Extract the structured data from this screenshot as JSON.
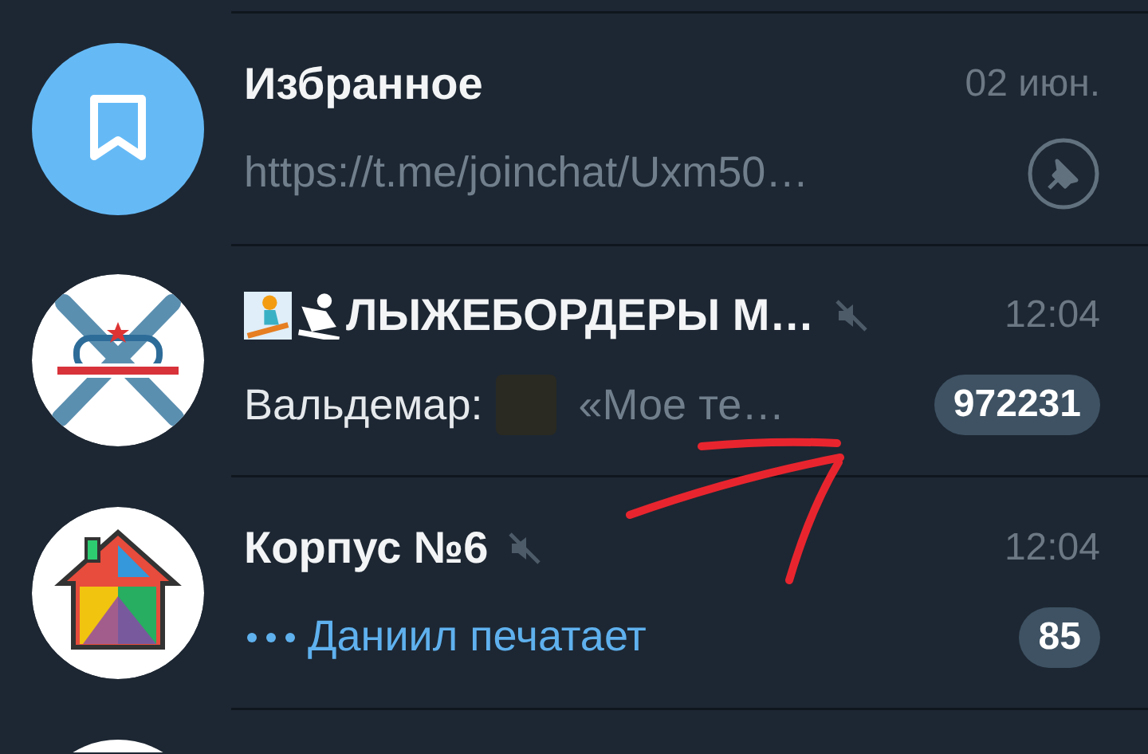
{
  "chats": [
    {
      "avatar": {
        "kind": "bookmark"
      },
      "title": "Избранное",
      "muted": false,
      "time": "02 июн.",
      "preview": [
        {
          "kind": "link",
          "text": "https://t.me/joinchat/Uxm50…"
        }
      ],
      "pinned": true
    },
    {
      "avatar": {
        "kind": "skis"
      },
      "title_icons": [
        {
          "kind": "snowboarder"
        },
        {
          "kind": "skier"
        }
      ],
      "title": "ЛЫЖЕБОРДЕРЫ М…",
      "muted": true,
      "time": "12:04",
      "preview": [
        {
          "kind": "sender",
          "text": "Вальдемар:"
        },
        {
          "kind": "photo"
        },
        {
          "kind": "text",
          "text": "«Мое те…"
        }
      ],
      "pinned": false,
      "unread": "972231"
    },
    {
      "avatar": {
        "kind": "house"
      },
      "title": "Корпус №6",
      "muted": true,
      "time": "12:04",
      "preview": [
        {
          "kind": "typing",
          "text": "Даниил печатает"
        }
      ],
      "pinned": false,
      "unread": "85"
    }
  ]
}
